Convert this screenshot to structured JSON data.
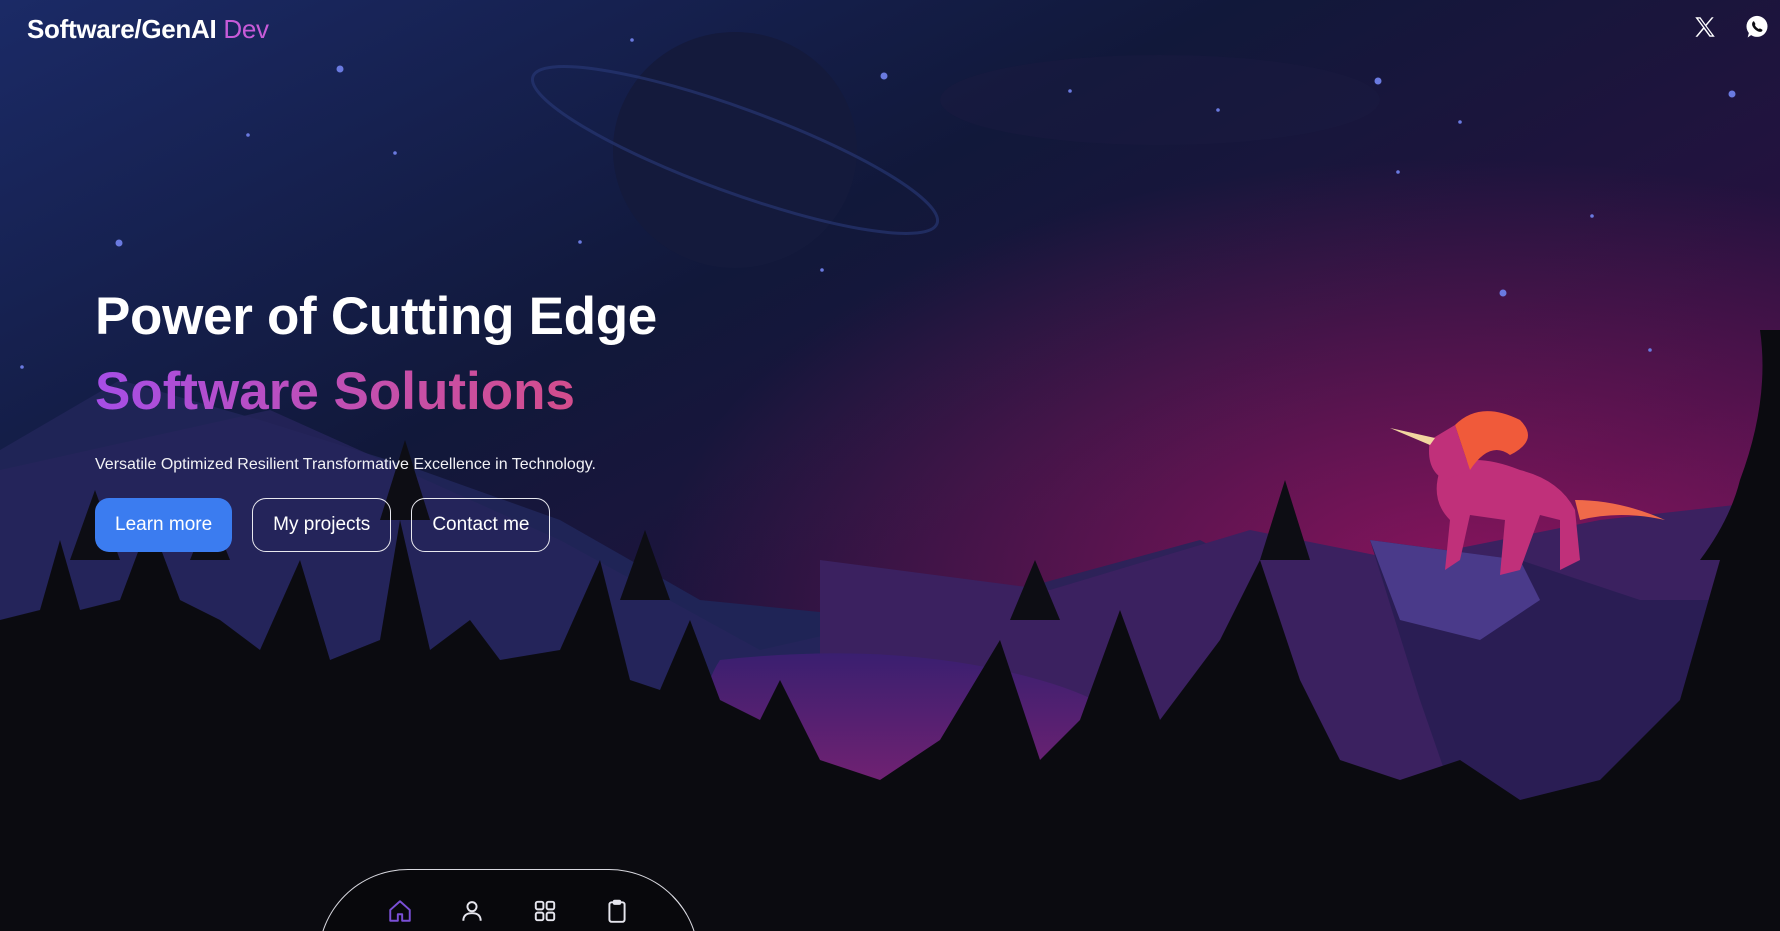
{
  "brand": {
    "name": "Software/GenAI",
    "accent": "Dev"
  },
  "social": [
    {
      "icon": "x-twitter-icon"
    },
    {
      "icon": "whatsapp-icon"
    }
  ],
  "hero": {
    "title": "Power of Cutting Edge",
    "subtitle": "Software Solutions",
    "tagline": "Versatile Optimized Resilient Transformative Excellence in Technology."
  },
  "actions": {
    "learn_more": "Learn more",
    "my_projects": "My projects",
    "contact_me": "Contact me"
  },
  "dock": [
    {
      "icon": "home-icon",
      "active": true
    },
    {
      "icon": "user-icon",
      "active": false
    },
    {
      "icon": "grid-icon",
      "active": false
    },
    {
      "icon": "clipboard-icon",
      "active": false
    }
  ],
  "colors": {
    "accent_purple": "#c75bd8",
    "primary_button": "#3b7cf0",
    "gradient_start": "#a64ee6",
    "gradient_end": "#e24a6d",
    "active_nav": "#7a4fd6"
  }
}
